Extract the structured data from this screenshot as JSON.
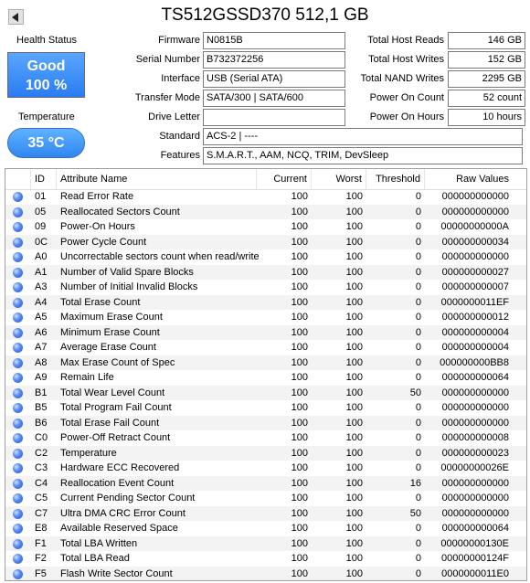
{
  "title": "TS512GSSD370 512,1 GB",
  "health": {
    "label": "Health Status",
    "status": "Good",
    "percent": "100 %"
  },
  "temperature": {
    "label": "Temperature",
    "value": "35 °C"
  },
  "fields": {
    "firmware": {
      "label": "Firmware",
      "value": "N0815B"
    },
    "serial": {
      "label": "Serial Number",
      "value": "B732372256"
    },
    "interface": {
      "label": "Interface",
      "value": "USB (Serial ATA)"
    },
    "transfer": {
      "label": "Transfer Mode",
      "value": "SATA/300 | SATA/600"
    },
    "drive_letter": {
      "label": "Drive Letter",
      "value": ""
    },
    "standard": {
      "label": "Standard",
      "value": "ACS-2 | ----"
    },
    "features": {
      "label": "Features",
      "value": "S.M.A.R.T., AAM, NCQ, TRIM, DevSleep"
    }
  },
  "stats": {
    "host_reads": {
      "label": "Total Host Reads",
      "value": "146 GB"
    },
    "host_writes": {
      "label": "Total Host Writes",
      "value": "152 GB"
    },
    "nand_writes": {
      "label": "Total NAND Writes",
      "value": "2295 GB"
    },
    "power_count": {
      "label": "Power On Count",
      "value": "52 count"
    },
    "power_hours": {
      "label": "Power On Hours",
      "value": "10 hours"
    }
  },
  "table": {
    "headers": {
      "id": "ID",
      "name": "Attribute Name",
      "current": "Current",
      "worst": "Worst",
      "threshold": "Threshold",
      "raw": "Raw Values"
    },
    "rows": [
      [
        "01",
        "Read Error Rate",
        "100",
        "100",
        "0",
        "000000000000"
      ],
      [
        "05",
        "Reallocated Sectors Count",
        "100",
        "100",
        "0",
        "000000000000"
      ],
      [
        "09",
        "Power-On Hours",
        "100",
        "100",
        "0",
        "00000000000A"
      ],
      [
        "0C",
        "Power Cycle Count",
        "100",
        "100",
        "0",
        "000000000034"
      ],
      [
        "A0",
        "Uncorrectable sectors count when read/write",
        "100",
        "100",
        "0",
        "000000000000"
      ],
      [
        "A1",
        "Number of Valid Spare Blocks",
        "100",
        "100",
        "0",
        "000000000027"
      ],
      [
        "A3",
        "Number of Initial Invalid Blocks",
        "100",
        "100",
        "0",
        "000000000007"
      ],
      [
        "A4",
        "Total Erase Count",
        "100",
        "100",
        "0",
        "0000000011EF"
      ],
      [
        "A5",
        "Maximum Erase Count",
        "100",
        "100",
        "0",
        "000000000012"
      ],
      [
        "A6",
        "Minimum Erase Count",
        "100",
        "100",
        "0",
        "000000000004"
      ],
      [
        "A7",
        "Average Erase Count",
        "100",
        "100",
        "0",
        "000000000004"
      ],
      [
        "A8",
        "Max Erase Count of Spec",
        "100",
        "100",
        "0",
        "000000000BB8"
      ],
      [
        "A9",
        "Remain Life",
        "100",
        "100",
        "0",
        "000000000064"
      ],
      [
        "B1",
        "Total Wear Level Count",
        "100",
        "100",
        "50",
        "000000000000"
      ],
      [
        "B5",
        "Total Program Fail Count",
        "100",
        "100",
        "0",
        "000000000000"
      ],
      [
        "B6",
        "Total Erase Fail Count",
        "100",
        "100",
        "0",
        "000000000000"
      ],
      [
        "C0",
        "Power-Off Retract Count",
        "100",
        "100",
        "0",
        "000000000008"
      ],
      [
        "C2",
        "Temperature",
        "100",
        "100",
        "0",
        "000000000023"
      ],
      [
        "C3",
        "Hardware ECC Recovered",
        "100",
        "100",
        "0",
        "00000000026E"
      ],
      [
        "C4",
        "Reallocation Event Count",
        "100",
        "100",
        "16",
        "000000000000"
      ],
      [
        "C5",
        "Current Pending Sector Count",
        "100",
        "100",
        "0",
        "000000000000"
      ],
      [
        "C7",
        "Ultra DMA CRC Error Count",
        "100",
        "100",
        "50",
        "000000000000"
      ],
      [
        "E8",
        "Available Reserved Space",
        "100",
        "100",
        "0",
        "000000000064"
      ],
      [
        "F1",
        "Total LBA Written",
        "100",
        "100",
        "0",
        "00000000130E"
      ],
      [
        "F2",
        "Total LBA Read",
        "100",
        "100",
        "0",
        "00000000124F"
      ],
      [
        "F5",
        "Flash Write Sector Count",
        "100",
        "100",
        "0",
        "0000000011E0"
      ]
    ]
  }
}
